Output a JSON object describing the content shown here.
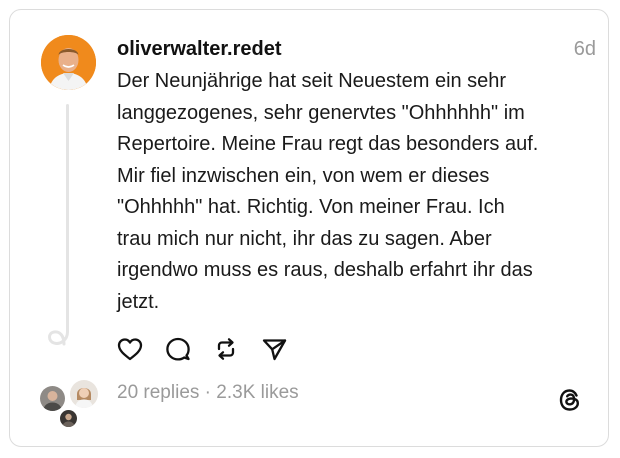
{
  "post": {
    "username": "oliverwalter.redet",
    "time": "6d",
    "text": "Der Neunjährige hat seit Neuestem ein sehr\nlanggezogenes, sehr genervtes \"Ohhhhhh\" im\nRepertoire. Meine Frau regt das besonders auf.\nMir fiel inzwischen ein, von wem er dieses\n\"Ohhhhh\" hat. Richtig. Von meiner Frau. Ich\ntrau mich nur nicht, ihr das zu sagen. Aber\nirgendwo muss es raus, deshalb erfahrt ihr das\njetzt."
  },
  "actions": {
    "like_icon": "heart-icon",
    "comment_icon": "comment-icon",
    "repost_icon": "repost-icon",
    "share_icon": "share-icon"
  },
  "stats": {
    "replies": "20 replies",
    "separator": " · ",
    "likes": "2.3K likes"
  },
  "colors": {
    "avatar_bg": "#f08a1c",
    "muted_text": "#9a9a9a",
    "border": "#dcdcdc"
  }
}
